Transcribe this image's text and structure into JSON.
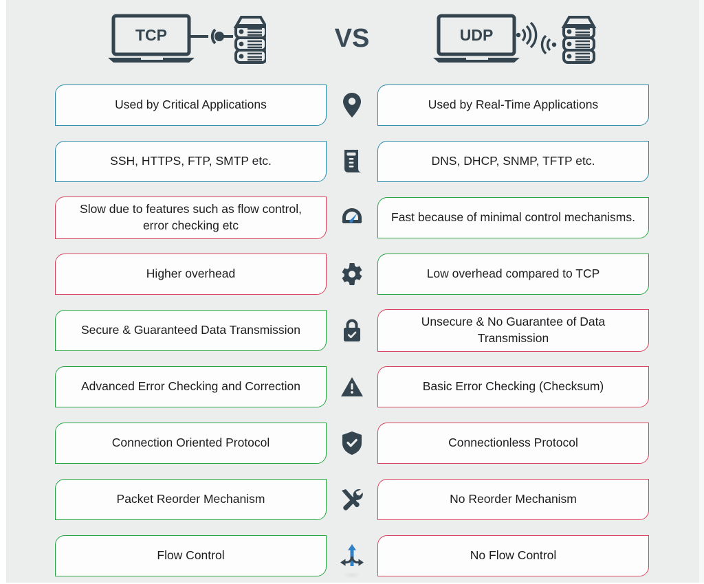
{
  "header": {
    "left_protocol_label": "TCP",
    "left_icon_name": "laptop-wired-server-icon",
    "vs_label": "VS",
    "right_protocol_label": "UDP",
    "right_icon_name": "laptop-wireless-server-icon"
  },
  "colors": {
    "blue": "#2c8aa8",
    "red": "#d9455f",
    "green": "#27a544",
    "background": "#eceded",
    "card_background": "#fdfdfd",
    "text": "#1d1d1f",
    "icon_dark": "#35454f",
    "icon_accent": "#2f80c7"
  },
  "rows": [
    {
      "icon": "location-pin-icon",
      "left": {
        "text": "Used by Critical Applications",
        "color": "blue"
      },
      "right": {
        "text": "Used by Real-Time Applications",
        "color": "blue"
      }
    },
    {
      "icon": "scroll-document-icon",
      "left": {
        "text": "SSH, HTTPS, FTP, SMTP etc.",
        "color": "blue"
      },
      "right": {
        "text": "DNS, DHCP, SNMP, TFTP etc.",
        "color": "blue"
      }
    },
    {
      "icon": "speedometer-icon",
      "left": {
        "text": "Slow due to features such as flow control, error checking etc",
        "color": "red"
      },
      "right": {
        "text": "Fast because of minimal control mechanisms.",
        "color": "green"
      }
    },
    {
      "icon": "gear-icon",
      "left": {
        "text": "Higher overhead",
        "color": "red"
      },
      "right": {
        "text": "Low overhead compared to TCP",
        "color": "green"
      }
    },
    {
      "icon": "lock-check-icon",
      "left": {
        "text": "Secure & Guaranteed Data Transmission",
        "color": "green"
      },
      "right": {
        "text": "Unsecure & No Guarantee of Data Transmission",
        "color": "red"
      }
    },
    {
      "icon": "warning-triangle-icon",
      "left": {
        "text": "Advanced Error Checking and Correction",
        "color": "green"
      },
      "right": {
        "text": "Basic Error Checking (Checksum)",
        "color": "red"
      }
    },
    {
      "icon": "shield-check-icon",
      "left": {
        "text": "Connection Oriented Protocol",
        "color": "green"
      },
      "right": {
        "text": "Connectionless Protocol",
        "color": "red"
      }
    },
    {
      "icon": "tools-icon",
      "left": {
        "text": "Packet Reorder Mechanism",
        "color": "green"
      },
      "right": {
        "text": "No Reorder Mechanism",
        "color": "red"
      }
    },
    {
      "icon": "branching-arrows-icon",
      "left": {
        "text": "Flow Control",
        "color": "green"
      },
      "right": {
        "text": "No Flow Control",
        "color": "red"
      }
    }
  ]
}
